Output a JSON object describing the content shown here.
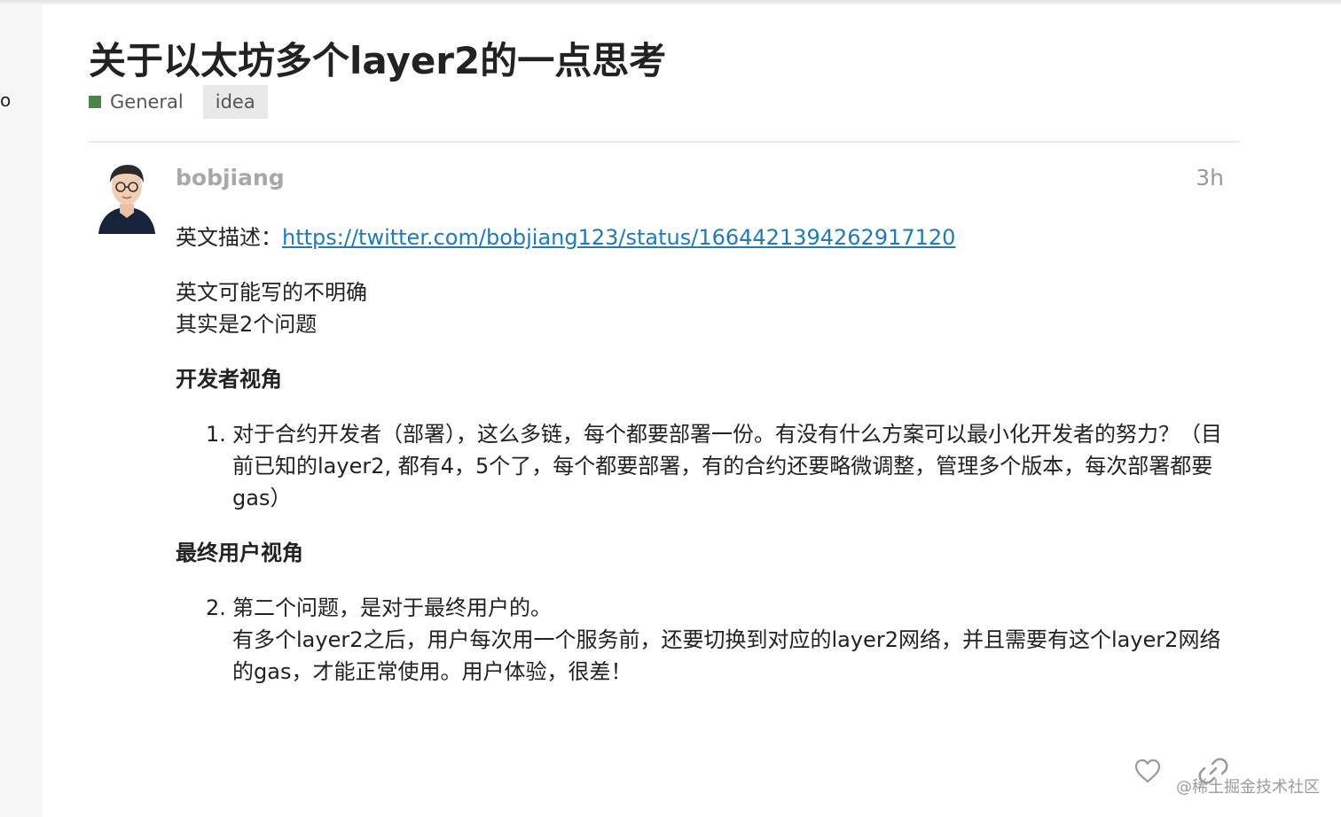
{
  "sidebar": {
    "partial_glyph": "o"
  },
  "topic": {
    "title": "关于以太坊多个layer2的一点思考",
    "category": {
      "name": "General",
      "color": "#4a8449"
    },
    "tags": [
      "idea"
    ]
  },
  "post": {
    "author": "bobjiang",
    "time": "3h",
    "avatar_icon": "user-avatar-icon",
    "link_prefix": "英文描述：",
    "link_text": "https://twitter.com/bobjiang123/status/1664421394262917120",
    "para1_line1": "英文可能写的不明确",
    "para1_line2": "其实是2个问题",
    "heading1": "开发者视角",
    "item1_number": "1.",
    "item1_text": "对于合约开发者（部署），这么多链，每个都要部署一份。有没有什么方案可以最小化开发者的努力？（目前已知的layer2, 都有4，5个了，每个都要部署，有的合约还要略微调整，管理多个版本，每次部署都要gas）",
    "heading2": "最终用户视角",
    "item2_number": "2.",
    "item2_line1": "第二个问题，是对于最终用户的。",
    "item2_line2": "有多个layer2之后，用户每次用一个服务前，还要切换到对应的layer2网络，并且需要有这个layer2网络的gas，才能正常使用。用户体验，很差！"
  },
  "actions": [
    {
      "icon": "heart-icon"
    },
    {
      "icon": "link-icon"
    }
  ],
  "watermark": "@稀土掘金技术社区"
}
